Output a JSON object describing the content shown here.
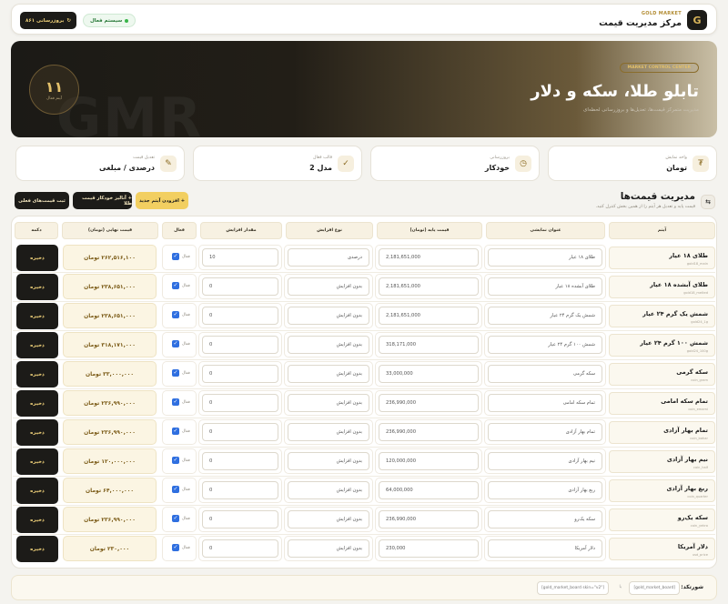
{
  "header": {
    "logo_letter": "G",
    "brand_sub": "GOLD MARKET",
    "brand_title": "مرکز مدیریت قیمت",
    "system_status": "سیستم فعال",
    "update_button": "بروزرسانی ۸۶۱",
    "status_color": "#39b54a",
    "accent_color": "#f2cf61"
  },
  "hero": {
    "badge": "MARKET CONTROL CENTER",
    "title": "تابلو طلا، سکه و دلار",
    "subtitle": "مدیریت متمرکز قیمت‌ها، تعدیل‌ها و بروزرسانی لحظه‌ای",
    "count": "۱۱",
    "count_label": "آیتم فعال",
    "watermark": "GMR"
  },
  "stats": [
    {
      "icon": "currency-icon",
      "glyph": "₮",
      "label": "واحد نمایش",
      "value": "تومان"
    },
    {
      "icon": "clock-icon",
      "glyph": "◷",
      "label": "بروزرسانی",
      "value": "خودکار"
    },
    {
      "icon": "check-icon",
      "glyph": "✓",
      "label": "قالب فعال",
      "value": "مدل 2"
    },
    {
      "icon": "edit-icon",
      "glyph": "✎",
      "label": "تعدیل قیمت",
      "value": "درصدی / مبلغی"
    }
  ],
  "section": {
    "icon_glyph": "⇆",
    "title": "مدیریت قیمت‌ها",
    "subtitle": "قیمت پایه و تعدیل هر آیتم را از همین بخش کنترل کنید.",
    "add_button": "+ افزودن آیتم جدید",
    "gold_button": "+ آنالیز خودکار قیمت طلا",
    "save_all_button": "ثبت قیمت‌های فعلی"
  },
  "table": {
    "columns": [
      "آیتم",
      "عنوان نمایشی",
      "قیمت پایه (تومان)",
      "نوع افزایش",
      "مقدار افزایش",
      "فعال",
      "قیمت نهایی (تومان)",
      "دکمه"
    ],
    "active_label": "فعال",
    "save_label": "ذخیره",
    "rows": [
      {
        "name": "طلای ۱۸ عیار",
        "key": "gold18_main",
        "display": "طلای ۱۸ عیار",
        "base": "2,181,651,000",
        "type": "درصدی",
        "amount": "10",
        "final": "۲۶۲,۵۱۶,۱۰۰ تومان"
      },
      {
        "name": "طلای آبشده ۱۸ عیار",
        "key": "gold18_melted",
        "display": "طلای آبشده ۱۸ عیار",
        "base": "2,181,651,000",
        "type": "بدون افزایش",
        "amount": "0",
        "final": "۲۳۸,۶۵۱,۰۰۰ تومان"
      },
      {
        "name": "شمش یک گرم ۲۴ عیار",
        "key": "gold24_1g",
        "display": "شمش یک گرم ۲۴ عیار",
        "base": "2,181,651,000",
        "type": "بدون افزایش",
        "amount": "0",
        "final": "۲۳۸,۶۵۱,۰۰۰ تومان"
      },
      {
        "name": "شمش ۱۰۰ گرم ۲۴ عیار",
        "key": "gold24_100g",
        "display": "شمش ۱۰۰ گرم ۲۴ عیار",
        "base": "318,171,000",
        "type": "بدون افزایش",
        "amount": "0",
        "final": "۳۱۸,۱۷۱,۰۰۰ تومان"
      },
      {
        "name": "سکه گرمی",
        "key": "coin_gram",
        "display": "سکه گرمی",
        "base": "33,000,000",
        "type": "بدون افزایش",
        "amount": "0",
        "final": "۳۳,۰۰۰,۰۰۰ تومان"
      },
      {
        "name": "تمام سکه امامی",
        "key": "coin_emami",
        "display": "تمام سکه امامی",
        "base": "236,990,000",
        "type": "بدون افزایش",
        "amount": "0",
        "final": "۲۳۶,۹۹۰,۰۰۰ تومان"
      },
      {
        "name": "تمام بهار آزادی",
        "key": "coin_bahar",
        "display": "تمام بهار آزادی",
        "base": "236,990,000",
        "type": "بدون افزایش",
        "amount": "0",
        "final": "۲۳۶,۹۹۰,۰۰۰ تومان"
      },
      {
        "name": "نیم بهار آزادی",
        "key": "coin_half",
        "display": "نیم بهار آزادی",
        "base": "120,000,000",
        "type": "بدون افزایش",
        "amount": "0",
        "final": "۱۲۰,۰۰۰,۰۰۰ تومان"
      },
      {
        "name": "ربع بهار آزادی",
        "key": "coin_quarter",
        "display": "ربع بهار آزادی",
        "base": "64,000,000",
        "type": "بدون افزایش",
        "amount": "0",
        "final": "۶۴,۰۰۰,۰۰۰ تومان"
      },
      {
        "name": "سکه یک‌رو",
        "key": "coin_yekro",
        "display": "سکه یک‌رو",
        "base": "236,990,000",
        "type": "بدون افزایش",
        "amount": "0",
        "final": "۲۳۶,۹۹۰,۰۰۰ تومان"
      },
      {
        "name": "دلار آمریکا",
        "key": "usd_price",
        "display": "دلار آمریکا",
        "base": "230,000",
        "type": "بدون افزایش",
        "amount": "0",
        "final": "۲۳۰,۰۰۰ تومان"
      }
    ]
  },
  "footer": {
    "label": "شورتکد:",
    "code1": "[gold_market_board]",
    "or": "یا",
    "code2": "[gold_market_board skin=\"v2\"]"
  }
}
